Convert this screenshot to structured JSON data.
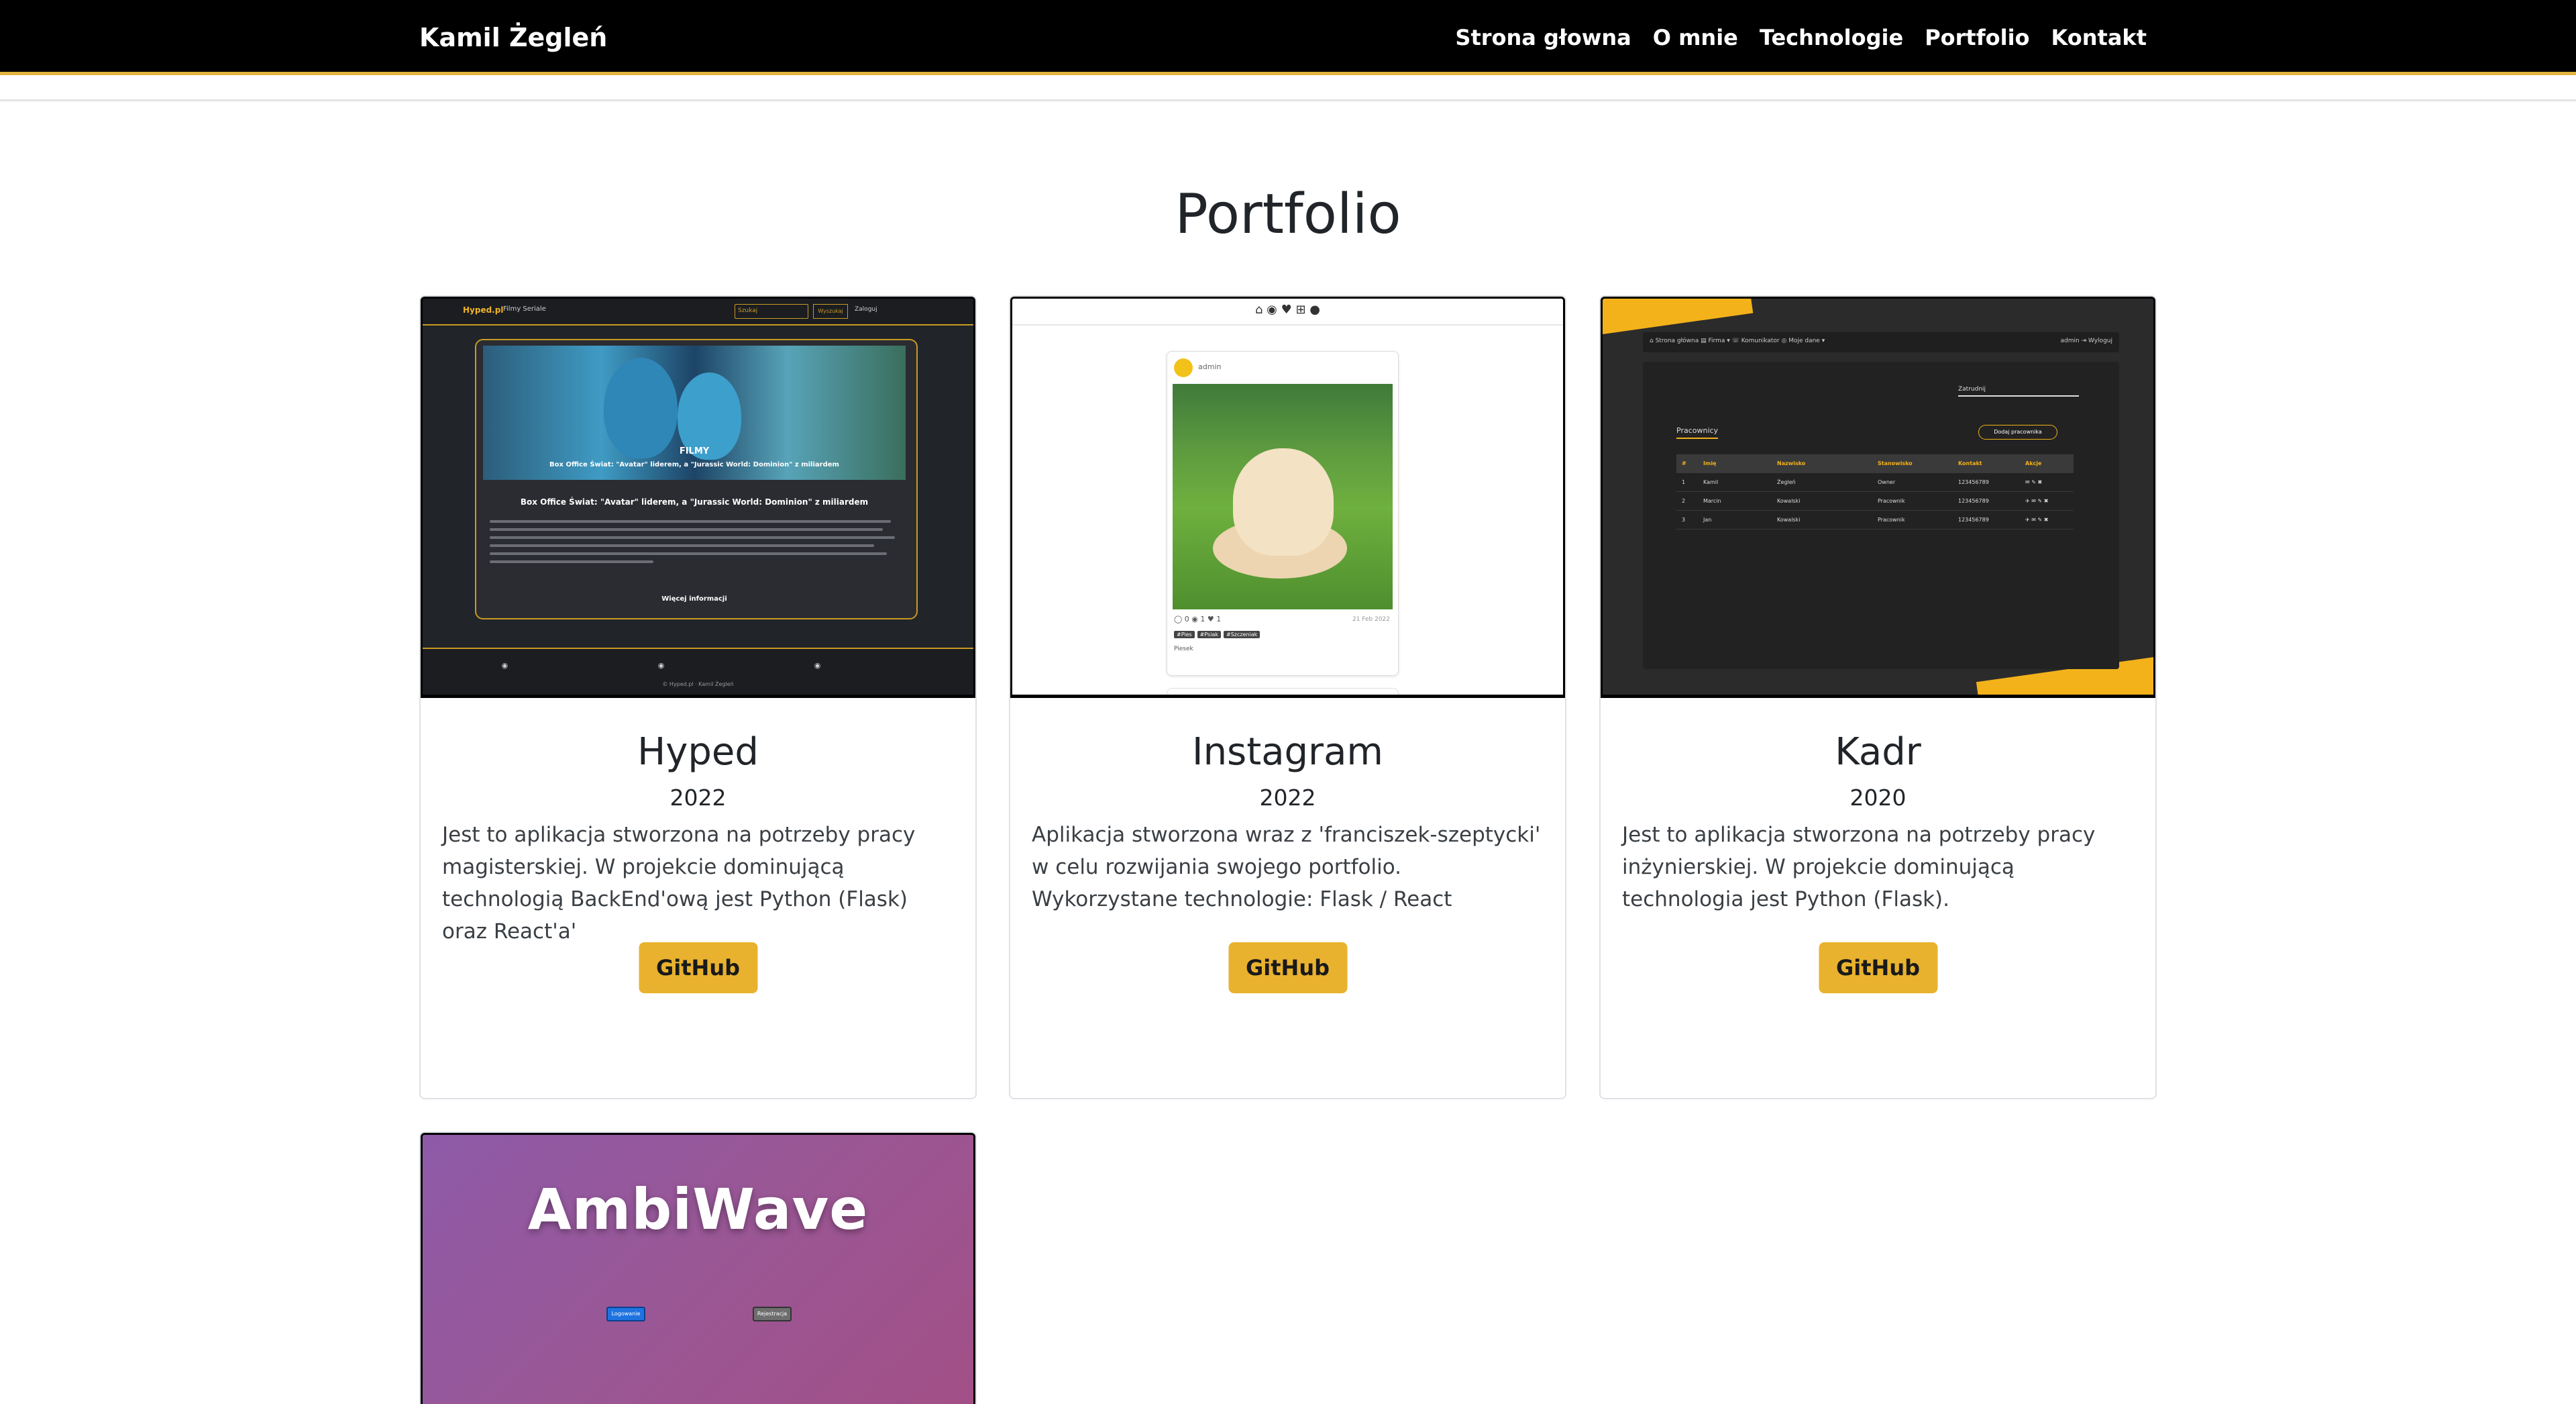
{
  "navbar": {
    "brand": "Kamil Żegleń",
    "links": [
      "Strona głowna",
      "O mnie",
      "Technologie",
      "Portfolio",
      "Kontakt"
    ]
  },
  "page": {
    "title": "Portfolio"
  },
  "projects": [
    {
      "name": "Hyped",
      "year": "2022",
      "description": "Jest to aplikacja stworzona na potrzeby pracy magisterskiej. W projekcie dominującą technologią BackEnd'ową jest Python (Flask) oraz React'a'",
      "button": "GitHub",
      "preview": {
        "brand": "Hyped.pl",
        "menu": "Filmy   Seriale",
        "search": "Szukaj",
        "search_button": "Wyszukaj",
        "login": "Zaloguj",
        "caption_small": "FILMY",
        "caption": "Box Office Świat: \"Avatar\" liderem, a \"Jurassic World: Dominion\" z miliardem",
        "headline": "Box Office Świat: \"Avatar\" liderem, a \"Jurassic World: Dominion\" z miliardem",
        "more": "Więcej informacji",
        "footer_icons": "◉ ◉ ◉",
        "copyright": "© Hyped.pl · Kamil Żegleń"
      }
    },
    {
      "name": "Instagram",
      "year": "2022",
      "description": "Aplikacja stworzona wraz z 'franciszek-szeptycki' w celu rozwijania swojego portfolio. Wykorzystane technologie: Flask / React",
      "button": "GitHub",
      "preview": {
        "nav_icons": "⌂ ◉ ♥ ⊞ ●",
        "user": "admin",
        "actions": "◯ 0   ◉ 1   ♥ 1",
        "date": "21 Feb 2022",
        "tags": [
          "#Pies",
          "#Psiak",
          "#Szczeniak"
        ],
        "caption": "Piesek"
      }
    },
    {
      "name": "Kadr",
      "year": "2020",
      "description": "Jest to aplikacja stworzona na potrzeby pracy inżynierskiej. W projekcie dominującą technologia jest Python (Flask).",
      "button": "GitHub",
      "preview": {
        "nav": "⌂ Strona główna    ▤ Firma ▾    ☏ Komunikator    ◎ Moje dane ▾",
        "nav_right": "admin    ⇥ Wyloguj",
        "tab": "Zatrudnij",
        "heading": "Pracownicy",
        "add_button": "Dodaj pracownika",
        "columns": [
          "#",
          "Imię",
          "Nazwisko",
          "Stanowisko",
          "Kontakt",
          "Akcje"
        ],
        "rows": [
          [
            "1",
            "Kamil",
            "Żegleń",
            "Owner",
            "123456789",
            "✉ ✎ ✖"
          ],
          [
            "2",
            "Marcin",
            "Kowalski",
            "Pracownik",
            "123456789",
            "✈ ✉ ✎ ✖"
          ],
          [
            "3",
            "Jan",
            "Kowalski",
            "Pracownik",
            "123456789",
            "✈ ✉ ✎ ✖"
          ]
        ]
      }
    },
    {
      "name": "AmbiWave",
      "preview": {
        "title": "AmbiWave",
        "login_button": "Logowanie",
        "register_button": "Rejestracja"
      }
    }
  ],
  "colors": {
    "navbar_bg": "#000000",
    "accent": "#e9b22e",
    "text": "#212529"
  }
}
